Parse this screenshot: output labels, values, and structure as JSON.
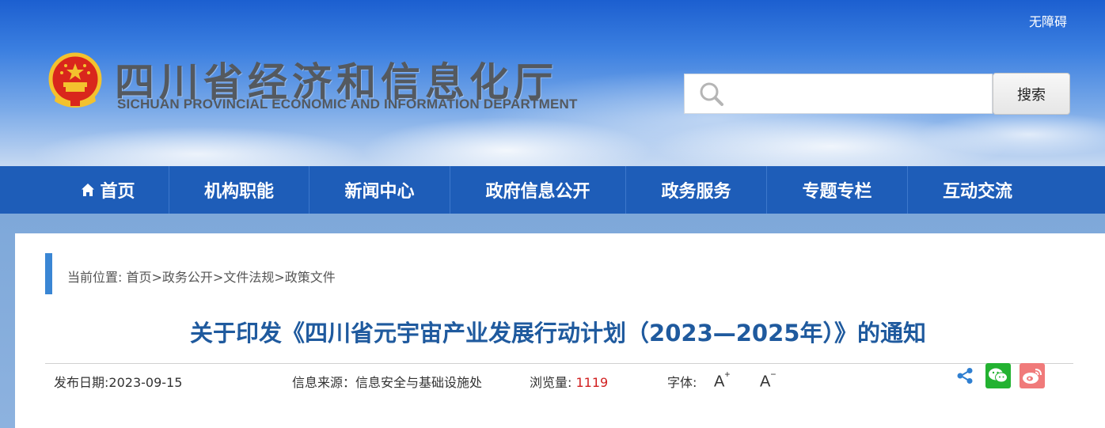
{
  "header": {
    "accessibility_label": "无障碍",
    "site_title": "四川省经济和信息化厅",
    "site_subtitle": "SICHUAN PROVINCIAL ECONOMIC AND INFORMATION DEPARTMENT",
    "emblem_icon": "national-emblem-icon",
    "search": {
      "placeholder": "",
      "button_label": "搜索",
      "icon": "search-icon"
    }
  },
  "nav": {
    "items": [
      {
        "label": "首页",
        "icon": "home-icon"
      },
      {
        "label": "机构职能"
      },
      {
        "label": "新闻中心"
      },
      {
        "label": "政府信息公开"
      },
      {
        "label": "政务服务"
      },
      {
        "label": "专题专栏"
      },
      {
        "label": "互动交流"
      }
    ]
  },
  "breadcrumb": {
    "prefix": "当前位置: ",
    "items": [
      "首页",
      "政务公开",
      "文件法规",
      "政策文件"
    ],
    "separator": ">"
  },
  "article": {
    "title": "关于印发《四川省元宇宙产业发展行动计划（2023—2025年）》的通知",
    "publish_date_label": "发布日期:",
    "publish_date": "2023-09-15",
    "source_label": "信息来源：",
    "source": "信息安全与基础设施处",
    "views_label": "浏览量: ",
    "views": "1119",
    "font_label": "字体:",
    "font_increase": "A",
    "font_decrease": "A",
    "share_icons": [
      "share-icon",
      "wechat-icon",
      "weibo-icon"
    ]
  },
  "colors": {
    "nav_bg": "#1e5db8",
    "title_color": "#1f5a9e",
    "views_color": "#d11f1f",
    "accent_bar": "#3a86d4"
  }
}
